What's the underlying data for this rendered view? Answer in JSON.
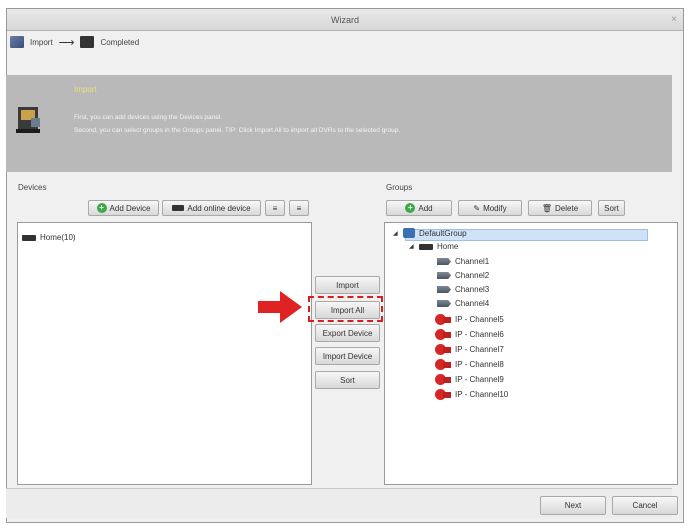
{
  "window": {
    "title": "Wizard",
    "close_glyph": "×"
  },
  "steps": {
    "import_label": "Import",
    "arrow_glyph": "⟶",
    "completed_label": "Completed"
  },
  "banner": {
    "title": "Import",
    "line1": "First, you can add devices using the Devices panel.",
    "line2": "Second, you can select groups in the Groups panel. TIP: Click Import All to import all DVRs to the selected group."
  },
  "devices": {
    "label": "Devices",
    "add_device": "Add Device",
    "add_online_device": "Add online device",
    "btn_x": "≡",
    "btn_r": "≡",
    "items": [
      {
        "label": "Home(10)"
      }
    ]
  },
  "middle": {
    "import": "Import",
    "import_all": "Import All",
    "export_device": "Export Device",
    "import_device": "Import Device",
    "sort": "Sort"
  },
  "groups": {
    "label": "Groups",
    "add": "Add",
    "modify": "Modify",
    "delete": "Delete",
    "sort": "Sort",
    "root": "DefaultGroup",
    "home": "Home",
    "channels": [
      "Channel1",
      "Channel2",
      "Channel3",
      "Channel4"
    ],
    "ip_channels": [
      "IP - Channel5",
      "IP - Channel6",
      "IP - Channel7",
      "IP - Channel8",
      "IP - Channel9",
      "IP - Channel10"
    ]
  },
  "footer": {
    "next": "Next",
    "cancel": "Cancel"
  },
  "colors": {
    "highlight": "#d42020",
    "selected": "#cfe2f7",
    "banner": "#b9b9b9"
  }
}
